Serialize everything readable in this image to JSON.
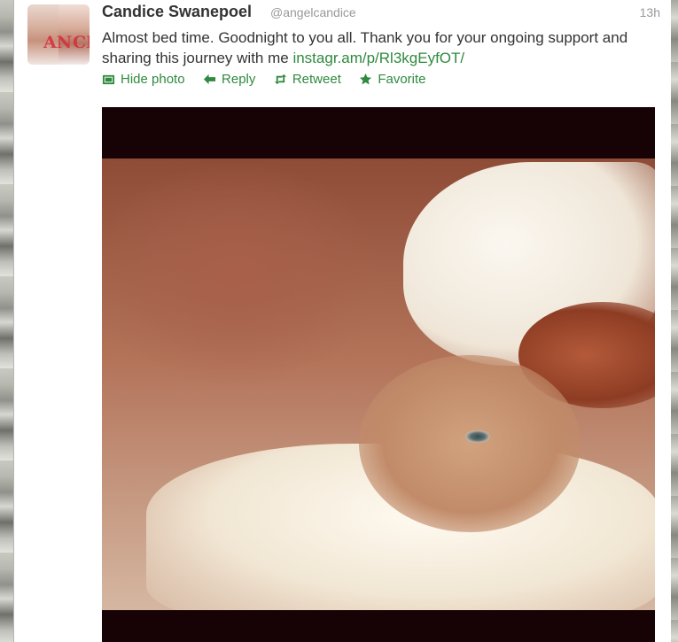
{
  "tweet": {
    "full_name": "Candice Swanepoel",
    "username": "@angelcandice",
    "timestamp": "13h",
    "text": "Almost bed time. Goodnight to you all. Thank you for your ongoing support and sharing this journey with me",
    "link": "instagr.am/p/Rl3kgEyfOT/",
    "avatar_letters": [
      "AN",
      "CE"
    ]
  },
  "actions": {
    "hide_photo": "Hide photo",
    "reply": "Reply",
    "retweet": "Retweet",
    "favorite": "Favorite"
  },
  "colors": {
    "link": "#2f8a3f",
    "name": "#333333",
    "meta": "#999999"
  },
  "icons": {
    "hide_photo": "photo-icon",
    "reply": "reply-arrow-icon",
    "retweet": "retweet-icon",
    "favorite": "star-icon"
  }
}
